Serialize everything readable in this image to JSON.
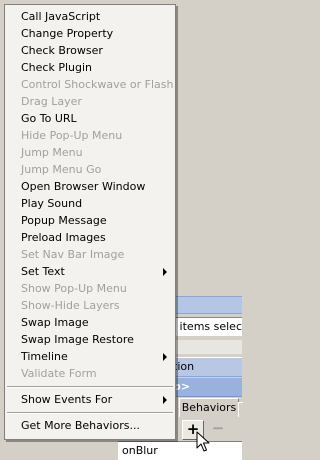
{
  "menu": {
    "items": [
      {
        "label": "Call JavaScript",
        "enabled": true,
        "submenu": false
      },
      {
        "label": "Change Property",
        "enabled": true,
        "submenu": false
      },
      {
        "label": "Check Browser",
        "enabled": true,
        "submenu": false
      },
      {
        "label": "Check Plugin",
        "enabled": true,
        "submenu": false
      },
      {
        "label": "Control Shockwave or Flash",
        "enabled": false,
        "submenu": false
      },
      {
        "label": "Drag Layer",
        "enabled": false,
        "submenu": false
      },
      {
        "label": "Go To URL",
        "enabled": true,
        "submenu": false
      },
      {
        "label": "Hide Pop-Up Menu",
        "enabled": false,
        "submenu": false
      },
      {
        "label": "Jump Menu",
        "enabled": false,
        "submenu": false
      },
      {
        "label": "Jump Menu Go",
        "enabled": false,
        "submenu": false
      },
      {
        "label": "Open Browser Window",
        "enabled": true,
        "submenu": false
      },
      {
        "label": "Play Sound",
        "enabled": true,
        "submenu": false
      },
      {
        "label": "Popup Message",
        "enabled": true,
        "submenu": false
      },
      {
        "label": "Preload Images",
        "enabled": true,
        "submenu": false
      },
      {
        "label": "Set Nav Bar Image",
        "enabled": false,
        "submenu": false
      },
      {
        "label": "Set Text",
        "enabled": true,
        "submenu": true
      },
      {
        "label": "Show Pop-Up Menu",
        "enabled": false,
        "submenu": false
      },
      {
        "label": "Show-Hide Layers",
        "enabled": false,
        "submenu": false
      },
      {
        "label": "Swap Image",
        "enabled": true,
        "submenu": false
      },
      {
        "label": "Swap Image Restore",
        "enabled": true,
        "submenu": false
      },
      {
        "label": "Timeline",
        "enabled": true,
        "submenu": true
      },
      {
        "label": "Validate Form",
        "enabled": false,
        "submenu": false
      }
    ],
    "show_events": {
      "label": "Show Events For",
      "submenu": true
    },
    "get_more": {
      "label": "Get More Behaviors..."
    }
  },
  "background": {
    "row1_text": "l items select",
    "row3_text": "tion",
    "row4_text": "p>",
    "tab_label": "Behaviors",
    "add_button": "+",
    "remove_button": "−",
    "event_label": "onBlur"
  }
}
